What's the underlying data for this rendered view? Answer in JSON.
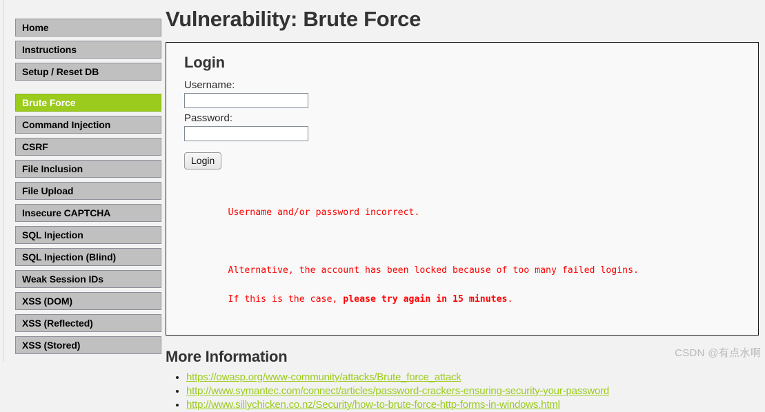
{
  "page": {
    "title": "Vulnerability: Brute Force",
    "background_color": "#f2f2f2",
    "accent_color": "#9bcb1c",
    "error_color": "#ff0000"
  },
  "sidebar": {
    "top_items": [
      {
        "label": "Home",
        "active": false
      },
      {
        "label": "Instructions",
        "active": false
      },
      {
        "label": "Setup / Reset DB",
        "active": false
      }
    ],
    "vuln_items": [
      {
        "label": "Brute Force",
        "active": true
      },
      {
        "label": "Command Injection",
        "active": false
      },
      {
        "label": "CSRF",
        "active": false
      },
      {
        "label": "File Inclusion",
        "active": false
      },
      {
        "label": "File Upload",
        "active": false
      },
      {
        "label": "Insecure CAPTCHA",
        "active": false
      },
      {
        "label": "SQL Injection",
        "active": false
      },
      {
        "label": "SQL Injection (Blind)",
        "active": false
      },
      {
        "label": "Weak Session IDs",
        "active": false
      },
      {
        "label": "XSS (DOM)",
        "active": false
      },
      {
        "label": "XSS (Reflected)",
        "active": false
      },
      {
        "label": "XSS (Stored)",
        "active": false
      }
    ]
  },
  "login_box": {
    "title": "Login",
    "username_label": "Username:",
    "username_value": "",
    "username_placeholder": "",
    "password_label": "Password:",
    "password_value": "",
    "password_placeholder": "",
    "submit_label": "Login",
    "error_line_1": "Username and/or password incorrect.",
    "error_line_2": "Alternative, the account has been locked because of too many failed logins.",
    "error_line_3_prefix": "If this is the case, ",
    "error_line_3_bold": "please try again in 15 minutes",
    "error_line_3_suffix": "."
  },
  "more_information": {
    "title": "More Information",
    "links": [
      "https://owasp.org/www-community/attacks/Brute_force_attack",
      "http://www.symantec.com/connect/articles/password-crackers-ensuring-security-your-password",
      "http://www.sillychicken.co.nz/Security/how-to-brute-force-http-forms-in-windows.html"
    ]
  },
  "watermark": {
    "text": "CSDN @有点水啊"
  }
}
